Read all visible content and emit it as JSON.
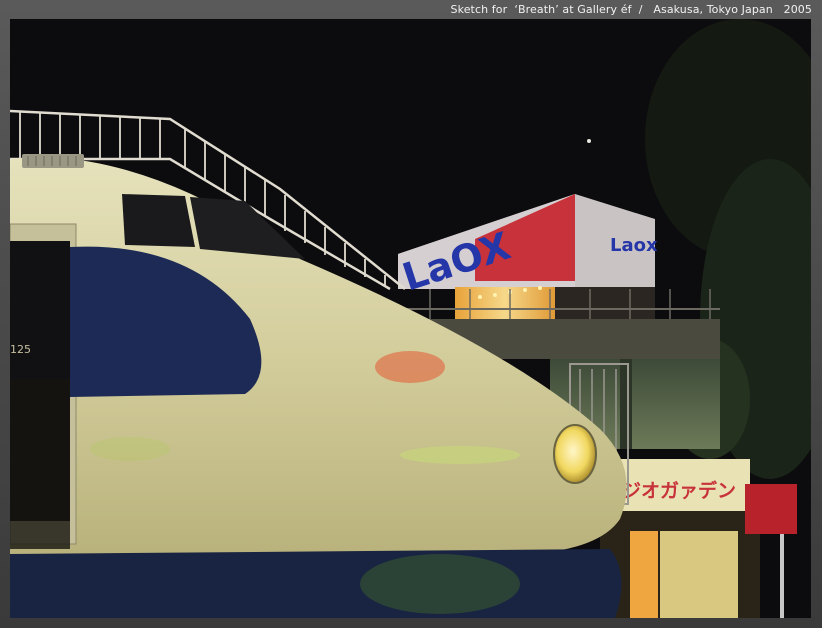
{
  "caption": "Sketch for  ‘Breath’ at Gallery éf  /   Asakusa, Tokyo Japan   2005",
  "photo": {
    "sign_main": "LaOX",
    "sign_side": "Laox",
    "shop_sign": "ジオガァデン",
    "train_number": "125"
  },
  "colors": {
    "frame": "#4a4a4a",
    "train_body": "#d9d4a6",
    "train_stripe": "#1c2a55",
    "sign_red": "#c8323a",
    "sign_blue": "#2436a8",
    "shop_sign_bg": "#e9e2b4"
  }
}
